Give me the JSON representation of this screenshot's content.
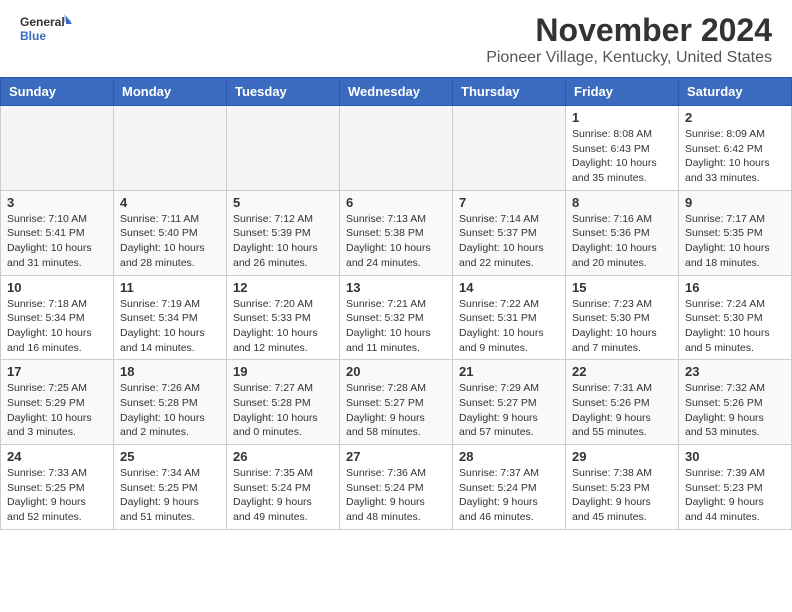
{
  "header": {
    "logo_line1": "General",
    "logo_line2": "Blue",
    "title": "November 2024",
    "subtitle": "Pioneer Village, Kentucky, United States"
  },
  "days_of_week": [
    "Sunday",
    "Monday",
    "Tuesday",
    "Wednesday",
    "Thursday",
    "Friday",
    "Saturday"
  ],
  "weeks": [
    [
      {
        "day": "",
        "info": "",
        "empty": true
      },
      {
        "day": "",
        "info": "",
        "empty": true
      },
      {
        "day": "",
        "info": "",
        "empty": true
      },
      {
        "day": "",
        "info": "",
        "empty": true
      },
      {
        "day": "",
        "info": "",
        "empty": true
      },
      {
        "day": "1",
        "info": "Sunrise: 8:08 AM\nSunset: 6:43 PM\nDaylight: 10 hours\nand 35 minutes."
      },
      {
        "day": "2",
        "info": "Sunrise: 8:09 AM\nSunset: 6:42 PM\nDaylight: 10 hours\nand 33 minutes."
      }
    ],
    [
      {
        "day": "3",
        "info": "Sunrise: 7:10 AM\nSunset: 5:41 PM\nDaylight: 10 hours\nand 31 minutes."
      },
      {
        "day": "4",
        "info": "Sunrise: 7:11 AM\nSunset: 5:40 PM\nDaylight: 10 hours\nand 28 minutes."
      },
      {
        "day": "5",
        "info": "Sunrise: 7:12 AM\nSunset: 5:39 PM\nDaylight: 10 hours\nand 26 minutes."
      },
      {
        "day": "6",
        "info": "Sunrise: 7:13 AM\nSunset: 5:38 PM\nDaylight: 10 hours\nand 24 minutes."
      },
      {
        "day": "7",
        "info": "Sunrise: 7:14 AM\nSunset: 5:37 PM\nDaylight: 10 hours\nand 22 minutes."
      },
      {
        "day": "8",
        "info": "Sunrise: 7:16 AM\nSunset: 5:36 PM\nDaylight: 10 hours\nand 20 minutes."
      },
      {
        "day": "9",
        "info": "Sunrise: 7:17 AM\nSunset: 5:35 PM\nDaylight: 10 hours\nand 18 minutes."
      }
    ],
    [
      {
        "day": "10",
        "info": "Sunrise: 7:18 AM\nSunset: 5:34 PM\nDaylight: 10 hours\nand 16 minutes."
      },
      {
        "day": "11",
        "info": "Sunrise: 7:19 AM\nSunset: 5:34 PM\nDaylight: 10 hours\nand 14 minutes."
      },
      {
        "day": "12",
        "info": "Sunrise: 7:20 AM\nSunset: 5:33 PM\nDaylight: 10 hours\nand 12 minutes."
      },
      {
        "day": "13",
        "info": "Sunrise: 7:21 AM\nSunset: 5:32 PM\nDaylight: 10 hours\nand 11 minutes."
      },
      {
        "day": "14",
        "info": "Sunrise: 7:22 AM\nSunset: 5:31 PM\nDaylight: 10 hours\nand 9 minutes."
      },
      {
        "day": "15",
        "info": "Sunrise: 7:23 AM\nSunset: 5:30 PM\nDaylight: 10 hours\nand 7 minutes."
      },
      {
        "day": "16",
        "info": "Sunrise: 7:24 AM\nSunset: 5:30 PM\nDaylight: 10 hours\nand 5 minutes."
      }
    ],
    [
      {
        "day": "17",
        "info": "Sunrise: 7:25 AM\nSunset: 5:29 PM\nDaylight: 10 hours\nand 3 minutes."
      },
      {
        "day": "18",
        "info": "Sunrise: 7:26 AM\nSunset: 5:28 PM\nDaylight: 10 hours\nand 2 minutes."
      },
      {
        "day": "19",
        "info": "Sunrise: 7:27 AM\nSunset: 5:28 PM\nDaylight: 10 hours\nand 0 minutes."
      },
      {
        "day": "20",
        "info": "Sunrise: 7:28 AM\nSunset: 5:27 PM\nDaylight: 9 hours\nand 58 minutes."
      },
      {
        "day": "21",
        "info": "Sunrise: 7:29 AM\nSunset: 5:27 PM\nDaylight: 9 hours\nand 57 minutes."
      },
      {
        "day": "22",
        "info": "Sunrise: 7:31 AM\nSunset: 5:26 PM\nDaylight: 9 hours\nand 55 minutes."
      },
      {
        "day": "23",
        "info": "Sunrise: 7:32 AM\nSunset: 5:26 PM\nDaylight: 9 hours\nand 53 minutes."
      }
    ],
    [
      {
        "day": "24",
        "info": "Sunrise: 7:33 AM\nSunset: 5:25 PM\nDaylight: 9 hours\nand 52 minutes."
      },
      {
        "day": "25",
        "info": "Sunrise: 7:34 AM\nSunset: 5:25 PM\nDaylight: 9 hours\nand 51 minutes."
      },
      {
        "day": "26",
        "info": "Sunrise: 7:35 AM\nSunset: 5:24 PM\nDaylight: 9 hours\nand 49 minutes."
      },
      {
        "day": "27",
        "info": "Sunrise: 7:36 AM\nSunset: 5:24 PM\nDaylight: 9 hours\nand 48 minutes."
      },
      {
        "day": "28",
        "info": "Sunrise: 7:37 AM\nSunset: 5:24 PM\nDaylight: 9 hours\nand 46 minutes."
      },
      {
        "day": "29",
        "info": "Sunrise: 7:38 AM\nSunset: 5:23 PM\nDaylight: 9 hours\nand 45 minutes."
      },
      {
        "day": "30",
        "info": "Sunrise: 7:39 AM\nSunset: 5:23 PM\nDaylight: 9 hours\nand 44 minutes."
      }
    ]
  ]
}
